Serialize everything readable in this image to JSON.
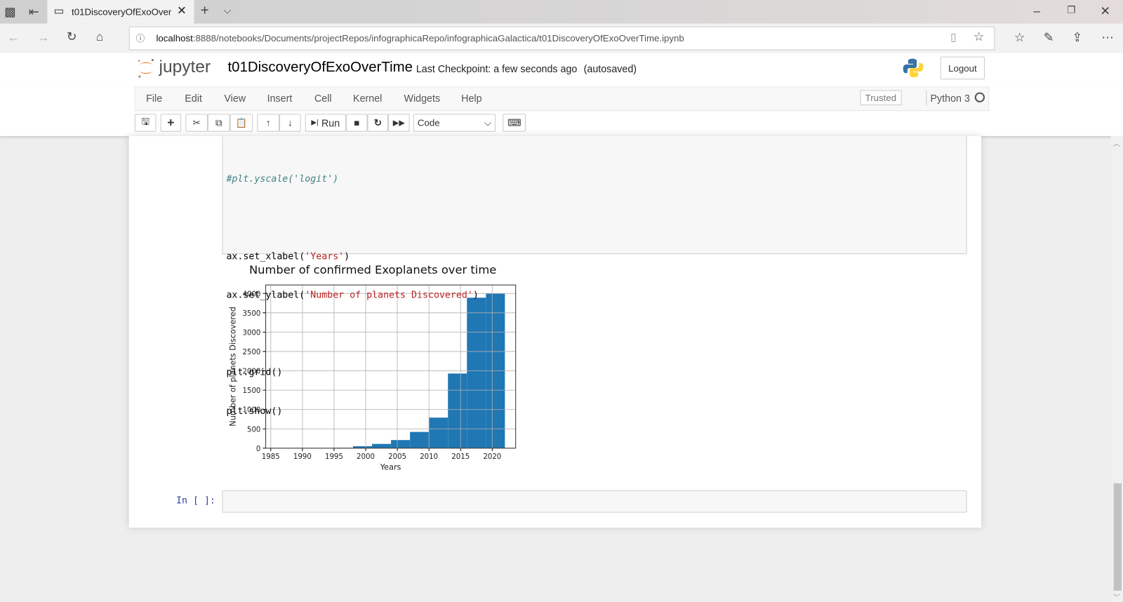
{
  "browser": {
    "tab_title": "t01DiscoveryOfExoOver",
    "url_host": "localhost",
    "url_rest": ":8888/notebooks/Documents/projectRepos/infographicaRepo/infographicaGalactica/t01DiscoveryOfExoOverTime.ipynb"
  },
  "header": {
    "logo_text": "jupyter",
    "notebook_name": "t01DiscoveryOfExoOverTime",
    "checkpoint": "Last Checkpoint: a few seconds ago",
    "autosaved": "(autosaved)",
    "logout": "Logout"
  },
  "menu": {
    "items": [
      "File",
      "Edit",
      "View",
      "Insert",
      "Cell",
      "Kernel",
      "Widgets",
      "Help"
    ],
    "trusted": "Trusted",
    "kernel": "Python 3"
  },
  "toolbar": {
    "run": "Run",
    "cell_type": "Code"
  },
  "code": {
    "line1": "#plt.yscale('logit')",
    "line2a": "ax.set_xlabel(",
    "line2s": "'Years'",
    "line2b": ")",
    "line3a": "ax.set_ylabel(",
    "line3s": "'Number of planets Discovered'",
    "line3b": ")",
    "line4": "plt.grid()",
    "line5": "plt.show()"
  },
  "empty_prompt": "In [ ]:",
  "colors": {
    "bar": "#1f77b4",
    "jupyter_orange": "#f37726",
    "prompt_blue": "#303f9f"
  },
  "chart_data": {
    "type": "bar",
    "title": "Number of confirmed Exoplanets over time",
    "xlabel": "Years",
    "ylabel": "Number of planets Discovered",
    "xlim": [
      1984.2,
      2023.7
    ],
    "ylim": [
      0,
      4220
    ],
    "xticks": [
      1985,
      1990,
      1995,
      2000,
      2005,
      2010,
      2015,
      2020
    ],
    "yticks": [
      0,
      500,
      1000,
      1500,
      2000,
      2500,
      3000,
      3500,
      4000
    ],
    "bin_edges": [
      1995,
      1998,
      2001,
      2004,
      2007,
      2010,
      2013,
      2016,
      2019,
      2022
    ],
    "values": [
      10,
      50,
      110,
      210,
      420,
      790,
      1930,
      3890,
      4000
    ],
    "grid": true
  }
}
